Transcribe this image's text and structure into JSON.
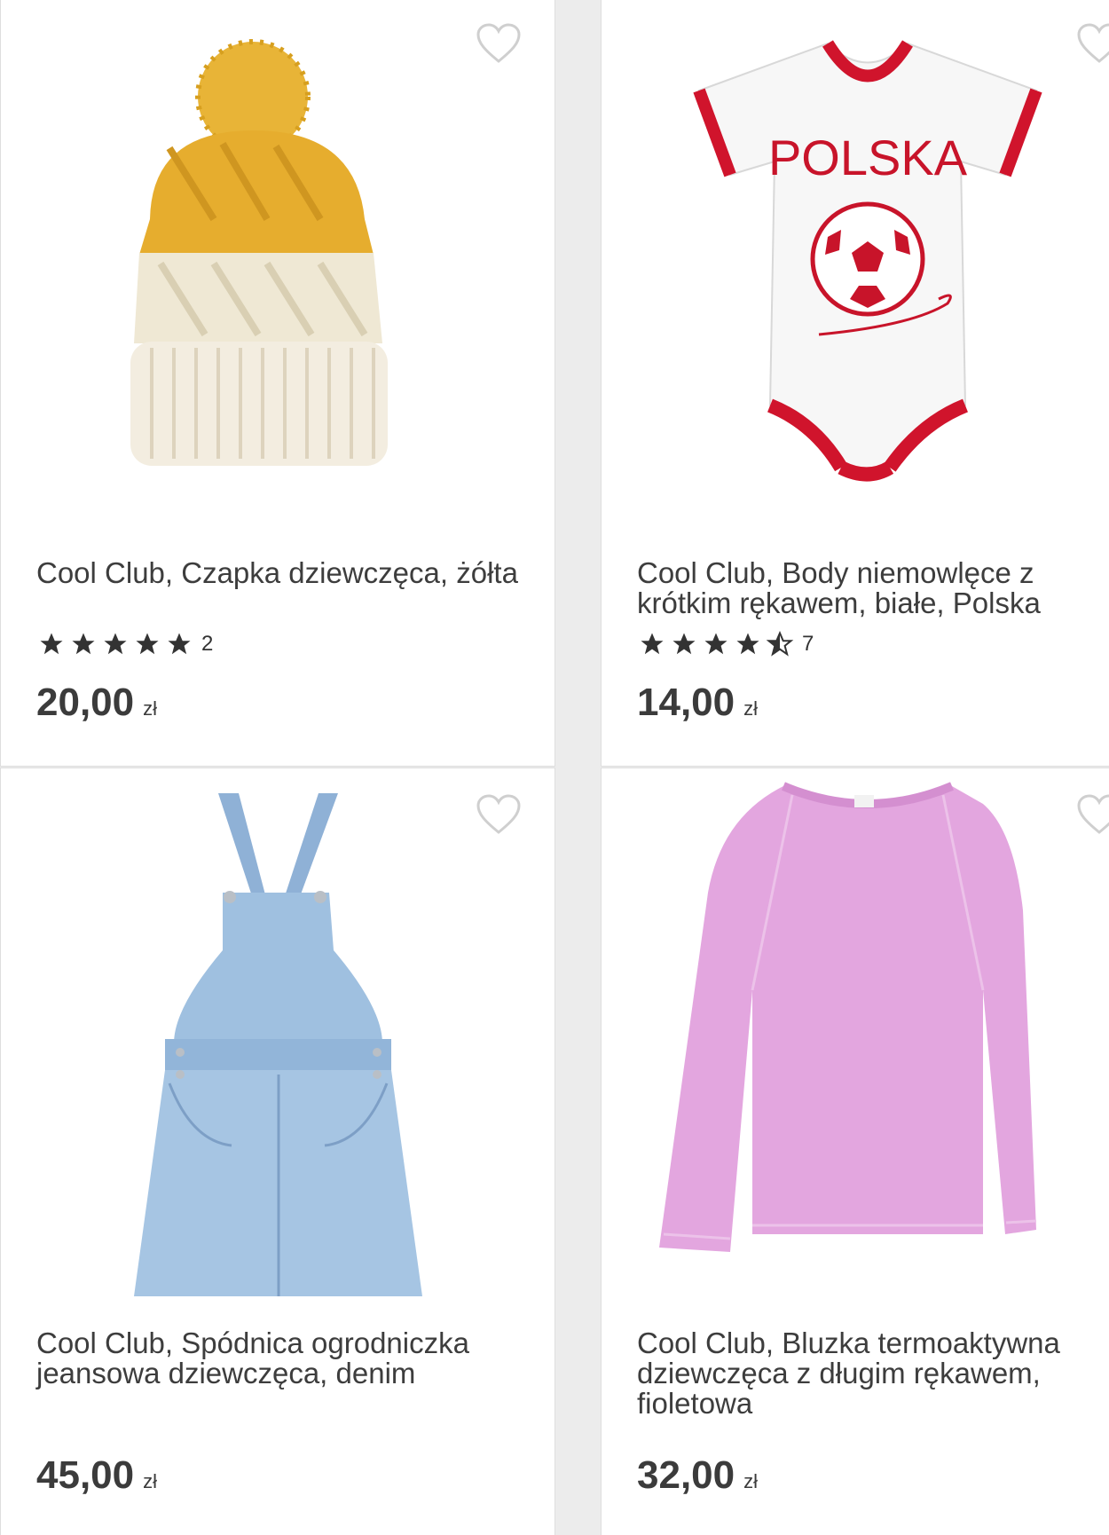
{
  "products": [
    {
      "name": "Cool Club, Czapka dziewczęca, żółta",
      "rating": 5,
      "review_count": "2",
      "price": "20,00",
      "currency": "zł",
      "image": "beanie-hat-icon"
    },
    {
      "name": "Cool Club, Body niemowlęce z krótkim rękawem, białe, Polska",
      "rating": 4.5,
      "review_count": "7",
      "price": "14,00",
      "currency": "zł",
      "image": "baby-bodysuit-icon",
      "print_text": "POLSKA"
    },
    {
      "name": "Cool Club, Spódnica ogrodniczka jeansowa dziewczęca, denim",
      "price": "45,00",
      "currency": "zł",
      "image": "denim-dress-icon"
    },
    {
      "name": "Cool Club, Bluzka termoaktywna dziewczęca z długim rękawem, fioletowa",
      "price": "32,00",
      "currency": "zł",
      "image": "long-sleeve-shirt-icon"
    }
  ],
  "colors": {
    "star": "#333333",
    "heart": "#cfcfcf",
    "background": "#ececec",
    "card": "#ffffff"
  }
}
